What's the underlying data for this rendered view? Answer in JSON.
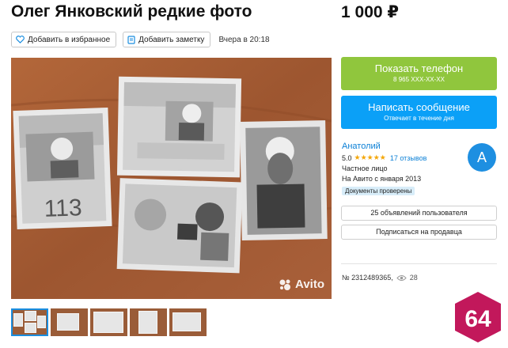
{
  "listing": {
    "title": "Олег Янковский редкие фото",
    "price": "1 000 ₽",
    "favorite_label": "Добавить в избранное",
    "note_label": "Добавить заметку",
    "posted": "Вчера в 20:18"
  },
  "gallery": {
    "watermark": "Avito",
    "thumbnail_count": 5
  },
  "contact": {
    "phone_label": "Показать телефон",
    "phone_masked": "8 965 XXX-XX-XX",
    "message_label": "Написать сообщение",
    "message_sub": "Отвечает в течение дня"
  },
  "seller": {
    "name": "Анатолий",
    "rating": "5.0",
    "stars": "★★★★★",
    "reviews": "17 отзывов",
    "type": "Частное лицо",
    "since": "На Авито с января 2013",
    "badge": "Документы проверены",
    "avatar_letter": "А",
    "ads_button": "25 объявлений пользователя",
    "subscribe_button": "Подписаться на продавца"
  },
  "item": {
    "number": "№ 2312489365,",
    "views": "28"
  },
  "logo": {
    "text": "64",
    "color": "#c2185b"
  },
  "colors": {
    "phone_button": "#90c63d",
    "message_button": "#0ba0f7",
    "link": "#0c80d6",
    "star": "#f4a70a"
  }
}
